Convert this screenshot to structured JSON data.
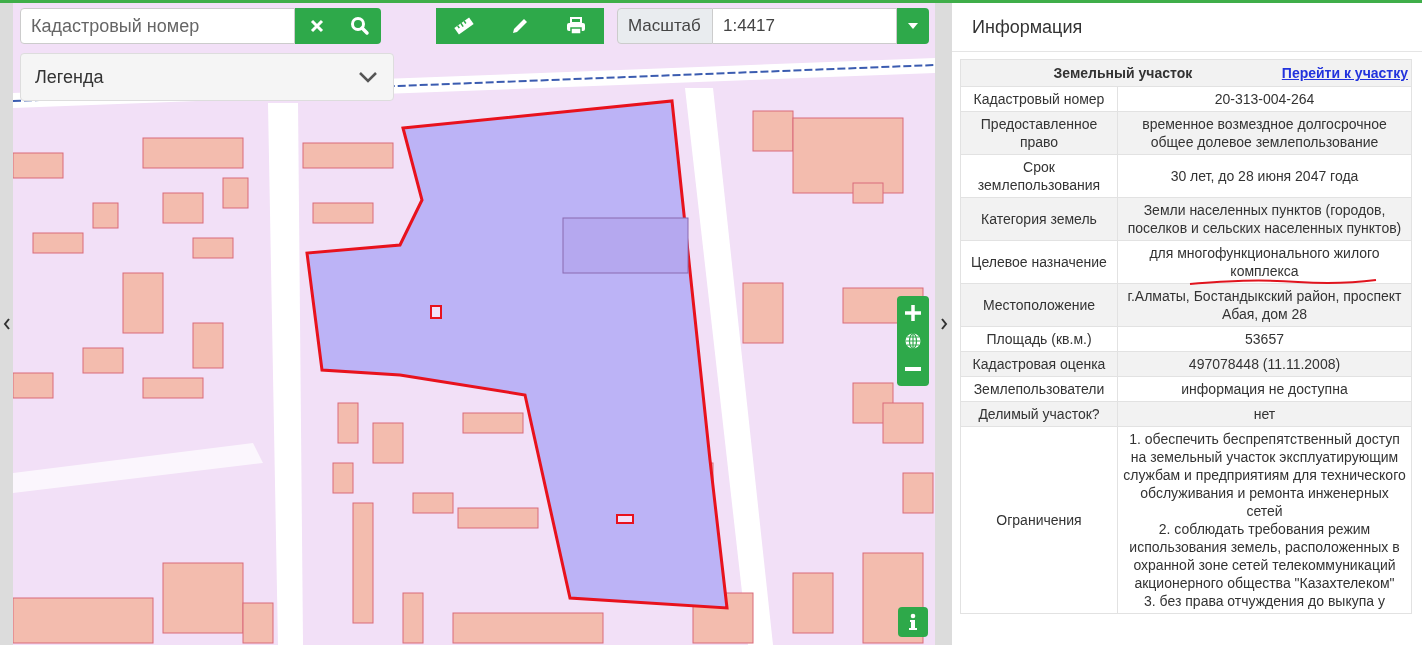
{
  "search": {
    "placeholder": "Кадастровый номер"
  },
  "legend": {
    "label": "Легенда"
  },
  "scale": {
    "label": "Масштаб",
    "value": "1:4417"
  },
  "panel": {
    "title": "Информация"
  },
  "parcel": {
    "heading": "Земельный участок",
    "link": "Перейти к участку",
    "rows": [
      {
        "label": "Кадастровый номер",
        "value": "20-313-004-264"
      },
      {
        "label": "Предоставленное право",
        "value": "временное возмездное долгосрочное общее долевое землепользование"
      },
      {
        "label": "Срок землепользования",
        "value": "30 лет, до 28 июня 2047 года"
      },
      {
        "label": "Категория земель",
        "value": "Земли населенных пунктов (городов, поселков и сельских населенных пунктов)"
      },
      {
        "label": "Целевое назначение",
        "value": "для многофункционального жилого комплекса",
        "underlined": true
      },
      {
        "label": "Местоположение",
        "value": "г.Алматы, Бостандыкский район, проспект Абая, дом 28"
      },
      {
        "label": "Площадь (кв.м.)",
        "value": "53657"
      },
      {
        "label": "Кадастровая оценка",
        "value": "497078448 (11.11.2008)"
      },
      {
        "label": "Землепользователи",
        "value": "информация не доступна"
      },
      {
        "label": "Делимый участок?",
        "value": "нет"
      },
      {
        "label": "Ограничения",
        "value": "1. обеспечить беспрепятственный доступ на земельный участок эксплуатирующим службам и предприятиям для технического обслуживания и ремонта инженерных сетей\n2. соблюдать требования режим использования земель, расположенных в охранной зоне сетей телекоммуникаций акционерного общества \"Казахтелеком\"\n3. без права отчуждения до выкупа у"
      }
    ]
  }
}
